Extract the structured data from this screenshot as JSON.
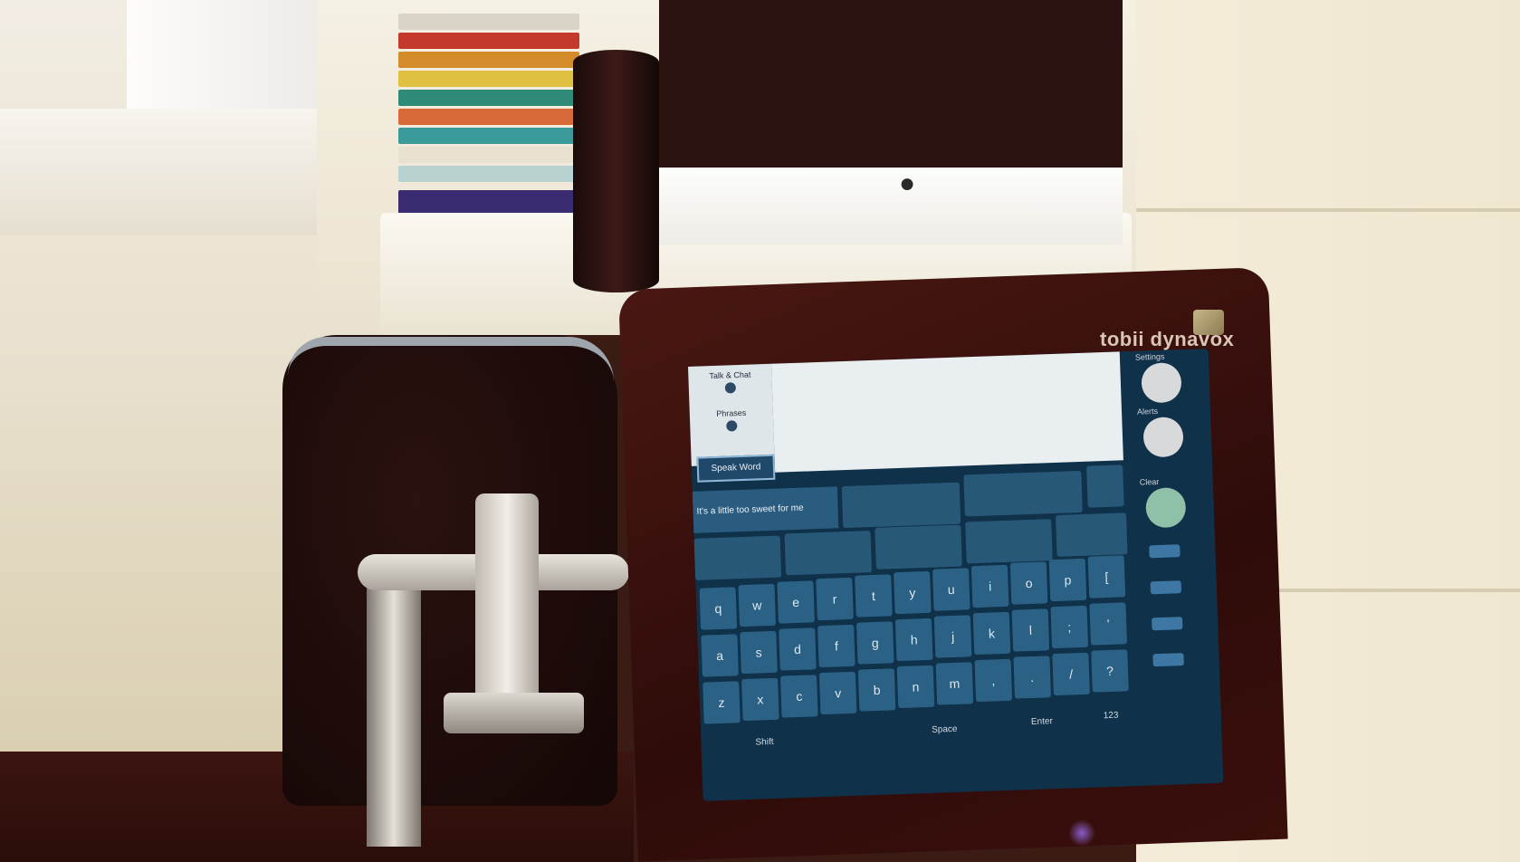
{
  "device": {
    "brand": "tobii dynavox"
  },
  "screen": {
    "side_panel": [
      {
        "label": "Talk & Chat",
        "icon": "chat-icon"
      },
      {
        "label": "Phrases",
        "icon": "phrase-icon"
      }
    ],
    "speak_button": "Speak Word",
    "message_text": "",
    "phrase_bar": "It's a little too sweet for me",
    "right_column": [
      {
        "label": "Settings",
        "icon": "settings-icon"
      },
      {
        "label": "Alerts",
        "icon": "alert-icon"
      },
      {
        "label": "Clear",
        "icon": "clear-icon"
      }
    ],
    "keyboard_rows": [
      [
        "q",
        "w",
        "e",
        "r",
        "t",
        "y",
        "u",
        "i",
        "o",
        "p",
        "["
      ],
      [
        "a",
        "s",
        "d",
        "f",
        "g",
        "h",
        "j",
        "k",
        "l",
        ";",
        "'"
      ],
      [
        "z",
        "x",
        "c",
        "v",
        "b",
        "n",
        "m",
        ",",
        ".",
        "/",
        "?"
      ]
    ],
    "bottom_labels": [
      "Shift",
      "Space",
      "Enter",
      "123"
    ]
  },
  "scene": {
    "apple_logo": ""
  }
}
